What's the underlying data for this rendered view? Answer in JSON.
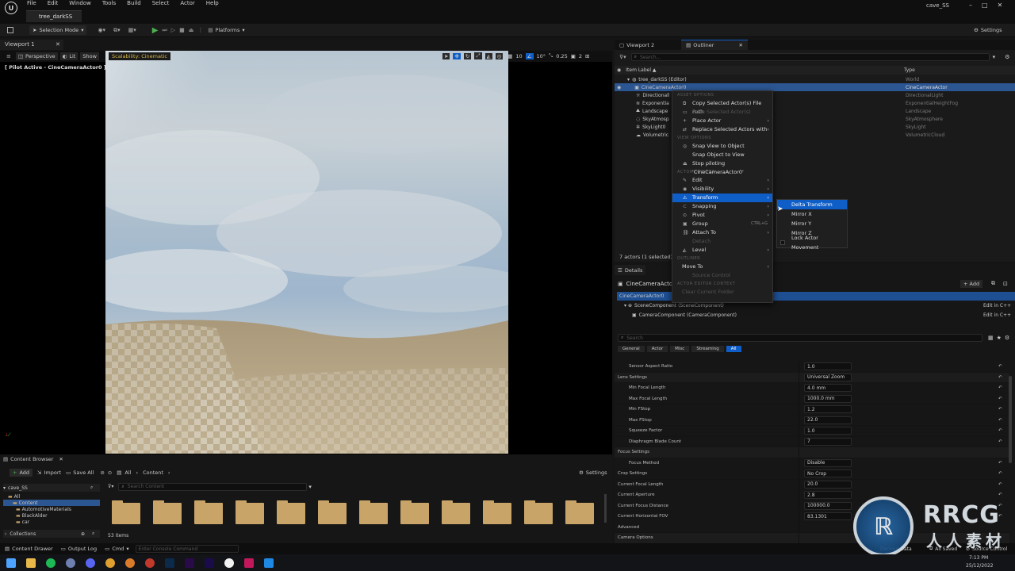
{
  "app": {
    "level_tab": "tree_darkSS",
    "project": "cave_SS",
    "menu": [
      "File",
      "Edit",
      "Window",
      "Tools",
      "Build",
      "Select",
      "Actor",
      "Help"
    ]
  },
  "toolbar": {
    "selection_mode": "Selection Mode",
    "platforms": "Platforms",
    "settings": "Settings"
  },
  "viewport": {
    "tab": "Viewport 1",
    "perspective": "Perspective",
    "lit": "Lit",
    "show": "Show",
    "scalability": "Scalability: Cinematic",
    "pilot": "[ Pilot Active - CineCameraActor0 ]",
    "grid": "10",
    "angle": "10°",
    "scale": "0.25",
    "cams": "2"
  },
  "outliner": {
    "tabs": [
      "Viewport 2",
      "Outliner"
    ],
    "search_placeholder": "Search...",
    "col_label": "Item Label ▲",
    "col_type": "Type",
    "rows": [
      {
        "label": "tree_darkSS (Editor)",
        "type": "World"
      },
      {
        "label": "CineCameraActor0",
        "type": "CineCameraActor"
      },
      {
        "label": "Directionall",
        "type": "DirectionalLight"
      },
      {
        "label": "Exponentia",
        "type": "ExponentialHeightFog"
      },
      {
        "label": "Landscape",
        "type": "Landscape"
      },
      {
        "label": "SkyAtmosp",
        "type": "SkyAtmosphere"
      },
      {
        "label": "SkyLight0",
        "type": "SkyLight"
      },
      {
        "label": "Volumetric",
        "type": "VolumetricCloud"
      }
    ],
    "status": "7 actors (1 selected)"
  },
  "context_menu": {
    "asset_options": "ASSET OPTIONS",
    "copy_path": "Copy Selected Actor(s) File Path",
    "save_selected": "Save Selected Actor(s)",
    "place_actor": "Place Actor",
    "replace_actors": "Replace Selected Actors with",
    "view_options": "VIEW OPTIONS",
    "snap_view": "Snap View to Object",
    "snap_object": "Snap Object to View",
    "stop_piloting": "Stop piloting 'CineCameraActor0'",
    "actor_options": "ACTOR OPTIONS",
    "edit": "Edit",
    "visibility": "Visibility",
    "transform": "Transform",
    "snapping": "Snapping",
    "pivot": "Pivot",
    "group": "Group",
    "group_shortcut": "CTRL+G",
    "attach": "Attach To",
    "detach": "Detach",
    "level": "Level",
    "outliner": "OUTLINER",
    "move_to": "Move To",
    "source_control": "Source Control",
    "actor_editor_context": "ACTOR EDITOR CONTEXT",
    "clear_folder": "Clear Current Folder"
  },
  "transform_menu": {
    "delta": "Delta Transform",
    "mx": "Mirror X",
    "my": "Mirror Y",
    "mz": "Mirror Z",
    "lock": "Lock Actor Movement"
  },
  "details": {
    "tab": "Details",
    "actor": "CineCameraActor0",
    "add": "+ Add",
    "scene_comp": "SceneComponent (SceneComponent)",
    "camera_comp": "CameraComponent (CameraComponent)",
    "edit_cpp": "Edit in C++",
    "search_placeholder": "Search",
    "filters": [
      "General",
      "Actor",
      "Misc",
      "Streaming",
      "All"
    ],
    "props": [
      {
        "k": "Sensor Aspect Ratio",
        "v": "1.0",
        "indent": 1
      },
      {
        "k": "Lens Settings",
        "v": "Universal Zoom",
        "indent": 0,
        "cat": true
      },
      {
        "k": "Min Focal Length",
        "v": "4.0 mm",
        "indent": 1
      },
      {
        "k": "Max Focal Length",
        "v": "1000.0 mm",
        "indent": 1
      },
      {
        "k": "Min FStop",
        "v": "1.2",
        "indent": 1
      },
      {
        "k": "Max FStop",
        "v": "22.0",
        "indent": 1
      },
      {
        "k": "Squeeze Factor",
        "v": "1.0",
        "indent": 1
      },
      {
        "k": "Diaphragm Blade Count",
        "v": "7",
        "indent": 1
      },
      {
        "k": "Focus Settings",
        "v": "",
        "indent": 0,
        "cat": true
      },
      {
        "k": "Focus Method",
        "v": "Disable",
        "indent": 1
      },
      {
        "k": "Crop Settings",
        "v": "No Crop",
        "indent": 0
      },
      {
        "k": "Current Focal Length",
        "v": "20.0",
        "indent": 0
      },
      {
        "k": "Current Aperture",
        "v": "2.8",
        "indent": 0
      },
      {
        "k": "Current Focus Distance",
        "v": "100000.0",
        "indent": 0
      },
      {
        "k": "Current Horizontal FOV",
        "v": "83.1301",
        "indent": 0
      },
      {
        "k": "Advanced",
        "v": "",
        "indent": 0
      },
      {
        "k": "Camera Options",
        "v": "",
        "indent": 0,
        "cat": true
      }
    ]
  },
  "content_browser": {
    "tab": "Content Browser",
    "add": "Add",
    "import": "Import",
    "save_all": "Save All",
    "crumb_all": "All",
    "crumb_content": "Content",
    "settings": "Settings",
    "project": "cave_SS",
    "search_placeholder": "Search Content",
    "tree": [
      "All",
      "Content",
      "AutomotiveMaterials",
      "BlackAlder",
      "car"
    ],
    "collections": "Collections",
    "count": "53 items"
  },
  "bottom": {
    "content_drawer": "Content Drawer",
    "output_log": "Output Log",
    "cmd": "Cmd",
    "console_placeholder": "Enter Console Command",
    "all_saved": "All Saved",
    "source_control": "Source Control",
    "derived_data": "Derived Data"
  },
  "taskbar": {
    "time": "7:13 PM",
    "date": "25/12/2022"
  },
  "watermark": {
    "main": "RRCG",
    "sub": "人人素材"
  }
}
